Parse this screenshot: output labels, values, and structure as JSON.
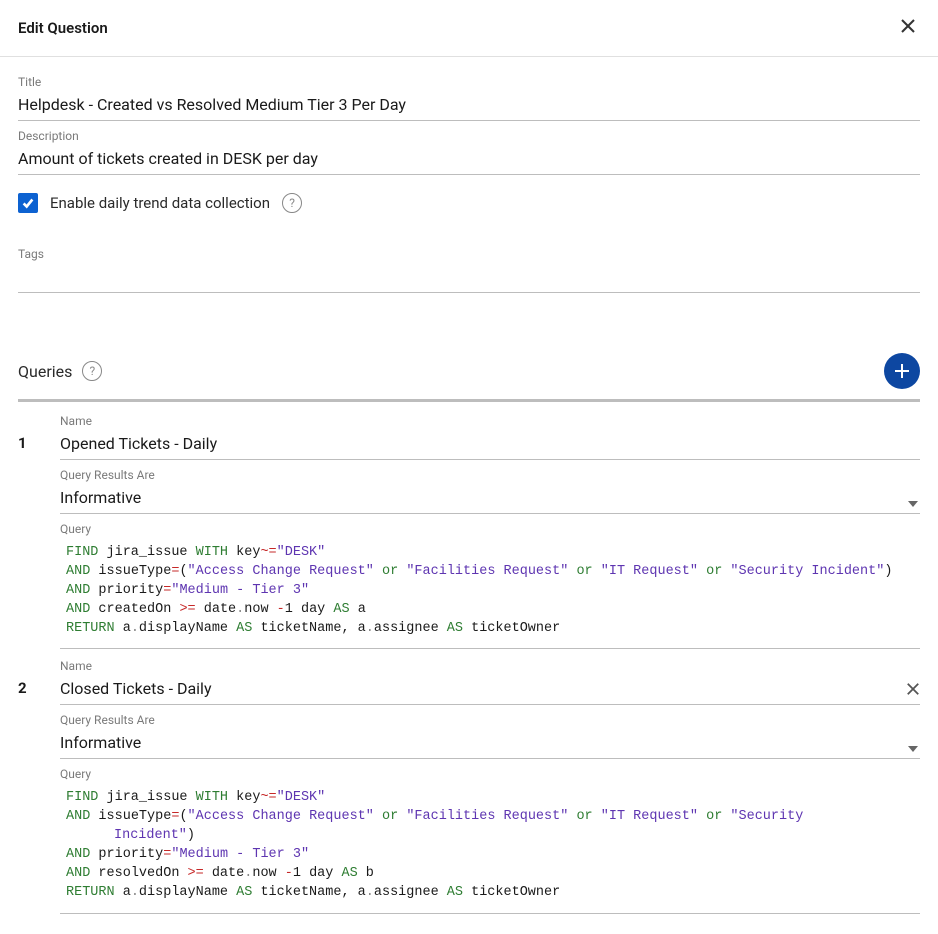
{
  "header": {
    "title": "Edit Question"
  },
  "fields": {
    "title_label": "Title",
    "title_value": "Helpdesk - Created vs Resolved Medium Tier 3 Per Day",
    "description_label": "Description",
    "description_value": "Amount of tickets created in DESK per day",
    "enable_trend_label": "Enable daily trend data collection",
    "enable_trend_checked": true,
    "tags_label": "Tags",
    "tags_value": ""
  },
  "queries_section": {
    "title": "Queries",
    "name_label": "Name",
    "results_label": "Query Results Are",
    "query_label": "Query",
    "items": [
      {
        "number": "1",
        "name": "Opened Tickets - Daily",
        "results_are": "Informative",
        "removable": false,
        "query_lines": [
          {
            "indent": false,
            "tokens": [
              {
                "cls": "kw",
                "t": "FIND"
              },
              {
                "cls": "ident",
                "t": " jira_issue "
              },
              {
                "cls": "kw",
                "t": "WITH"
              },
              {
                "cls": "ident",
                "t": " key"
              },
              {
                "cls": "op",
                "t": "~="
              },
              {
                "cls": "str",
                "t": "\"DESK\""
              }
            ]
          },
          {
            "indent": false,
            "tokens": [
              {
                "cls": "kw",
                "t": "AND"
              },
              {
                "cls": "ident",
                "t": " issueType"
              },
              {
                "cls": "op",
                "t": "="
              },
              {
                "cls": "ident",
                "t": "("
              },
              {
                "cls": "str",
                "t": "\"Access Change Request\""
              },
              {
                "cls": "ident",
                "t": " "
              },
              {
                "cls": "kw",
                "t": "or"
              },
              {
                "cls": "ident",
                "t": " "
              },
              {
                "cls": "str",
                "t": "\"Facilities Request\""
              },
              {
                "cls": "ident",
                "t": " "
              },
              {
                "cls": "kw",
                "t": "or"
              },
              {
                "cls": "ident",
                "t": " "
              },
              {
                "cls": "str",
                "t": "\"IT Request\""
              },
              {
                "cls": "ident",
                "t": " "
              },
              {
                "cls": "kw",
                "t": "or"
              },
              {
                "cls": "ident",
                "t": " "
              },
              {
                "cls": "str",
                "t": "\"Security Incident\""
              },
              {
                "cls": "ident",
                "t": ")"
              }
            ]
          },
          {
            "indent": false,
            "tokens": [
              {
                "cls": "kw",
                "t": "AND"
              },
              {
                "cls": "ident",
                "t": " priority"
              },
              {
                "cls": "op",
                "t": "="
              },
              {
                "cls": "str",
                "t": "\"Medium - Tier 3\""
              }
            ]
          },
          {
            "indent": false,
            "tokens": [
              {
                "cls": "kw",
                "t": "AND"
              },
              {
                "cls": "ident",
                "t": " createdOn "
              },
              {
                "cls": "op",
                "t": ">="
              },
              {
                "cls": "ident",
                "t": " date"
              },
              {
                "cls": "dot",
                "t": "."
              },
              {
                "cls": "ident",
                "t": "now "
              },
              {
                "cls": "op",
                "t": "-"
              },
              {
                "cls": "ident",
                "t": "1 day "
              },
              {
                "cls": "kw",
                "t": "AS"
              },
              {
                "cls": "ident",
                "t": " a"
              }
            ]
          },
          {
            "indent": false,
            "tokens": [
              {
                "cls": "kw",
                "t": "RETURN"
              },
              {
                "cls": "ident",
                "t": " a"
              },
              {
                "cls": "dot",
                "t": "."
              },
              {
                "cls": "ident",
                "t": "displayName "
              },
              {
                "cls": "kw",
                "t": "AS"
              },
              {
                "cls": "ident",
                "t": " ticketName, a"
              },
              {
                "cls": "dot",
                "t": "."
              },
              {
                "cls": "ident",
                "t": "assignee "
              },
              {
                "cls": "kw",
                "t": "AS"
              },
              {
                "cls": "ident",
                "t": " ticketOwner"
              }
            ]
          }
        ]
      },
      {
        "number": "2",
        "name": "Closed Tickets - Daily",
        "results_are": "Informative",
        "removable": true,
        "query_lines": [
          {
            "indent": false,
            "tokens": [
              {
                "cls": "kw",
                "t": "FIND"
              },
              {
                "cls": "ident",
                "t": " jira_issue "
              },
              {
                "cls": "kw",
                "t": "WITH"
              },
              {
                "cls": "ident",
                "t": " key"
              },
              {
                "cls": "op",
                "t": "~="
              },
              {
                "cls": "str",
                "t": "\"DESK\""
              }
            ]
          },
          {
            "indent": false,
            "tokens": [
              {
                "cls": "kw",
                "t": "AND"
              },
              {
                "cls": "ident",
                "t": " issueType"
              },
              {
                "cls": "op",
                "t": "="
              },
              {
                "cls": "ident",
                "t": "("
              },
              {
                "cls": "str",
                "t": "\"Access Change Request\""
              },
              {
                "cls": "ident",
                "t": " "
              },
              {
                "cls": "kw",
                "t": "or"
              },
              {
                "cls": "ident",
                "t": " "
              },
              {
                "cls": "str",
                "t": "\"Facilities Request\""
              },
              {
                "cls": "ident",
                "t": " "
              },
              {
                "cls": "kw",
                "t": "or"
              },
              {
                "cls": "ident",
                "t": " "
              },
              {
                "cls": "str",
                "t": "\"IT Request\""
              },
              {
                "cls": "ident",
                "t": " "
              },
              {
                "cls": "kw",
                "t": "or"
              },
              {
                "cls": "ident",
                "t": " "
              },
              {
                "cls": "str",
                "t": "\"Security "
              }
            ]
          },
          {
            "indent": true,
            "tokens": [
              {
                "cls": "str",
                "t": "Incident\""
              },
              {
                "cls": "ident",
                "t": ")"
              }
            ]
          },
          {
            "indent": false,
            "tokens": [
              {
                "cls": "kw",
                "t": "AND"
              },
              {
                "cls": "ident",
                "t": " priority"
              },
              {
                "cls": "op",
                "t": "="
              },
              {
                "cls": "str",
                "t": "\"Medium - Tier 3\""
              }
            ]
          },
          {
            "indent": false,
            "tokens": [
              {
                "cls": "kw",
                "t": "AND"
              },
              {
                "cls": "ident",
                "t": " resolvedOn "
              },
              {
                "cls": "op",
                "t": ">="
              },
              {
                "cls": "ident",
                "t": " date"
              },
              {
                "cls": "dot",
                "t": "."
              },
              {
                "cls": "ident",
                "t": "now "
              },
              {
                "cls": "op",
                "t": "-"
              },
              {
                "cls": "ident",
                "t": "1 day "
              },
              {
                "cls": "kw",
                "t": "AS"
              },
              {
                "cls": "ident",
                "t": " b"
              }
            ]
          },
          {
            "indent": false,
            "tokens": [
              {
                "cls": "kw",
                "t": "RETURN"
              },
              {
                "cls": "ident",
                "t": " a"
              },
              {
                "cls": "dot",
                "t": "."
              },
              {
                "cls": "ident",
                "t": "displayName "
              },
              {
                "cls": "kw",
                "t": "AS"
              },
              {
                "cls": "ident",
                "t": " ticketName, a"
              },
              {
                "cls": "dot",
                "t": "."
              },
              {
                "cls": "ident",
                "t": "assignee "
              },
              {
                "cls": "kw",
                "t": "AS"
              },
              {
                "cls": "ident",
                "t": " ticketOwner"
              }
            ]
          }
        ]
      }
    ]
  }
}
